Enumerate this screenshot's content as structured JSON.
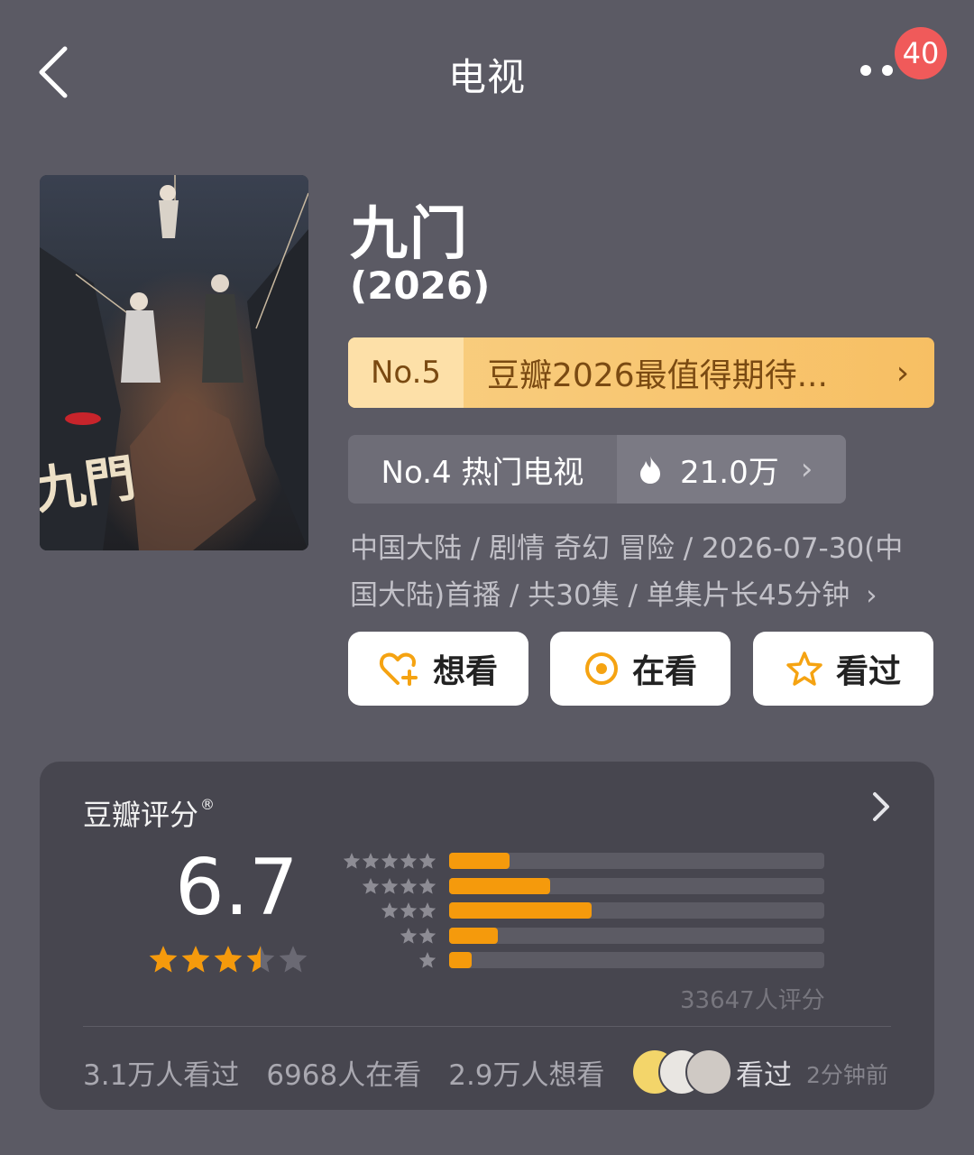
{
  "header": {
    "title": "电视",
    "badge_count": "40"
  },
  "show": {
    "title": "九门",
    "year": "(2026)",
    "poster_brand_mark": "九門"
  },
  "ranking_primary": {
    "no": "No.5",
    "label": "豆瓣2026最值得期待...",
    "chevron": "›"
  },
  "ranking_secondary": {
    "label": "No.4 热门电视",
    "heat": "21.0万",
    "chevron": "›"
  },
  "meta": {
    "text": "中国大陆 / 剧情 奇幻 冒险 / 2026-07-30(中国大陆)首播 / 共30集 / 单集片长45分钟",
    "chevron": "›"
  },
  "actions": {
    "want": "想看",
    "watching": "在看",
    "watched": "看过"
  },
  "rating": {
    "title": "豆瓣评分",
    "registered_mark": "®",
    "score": "6.7",
    "stars_value": 3.5,
    "rater_count": "33647人评分",
    "distribution": [
      {
        "stars": 5,
        "fraction": 0.16
      },
      {
        "stars": 4,
        "fraction": 0.27
      },
      {
        "stars": 3,
        "fraction": 0.38
      },
      {
        "stars": 2,
        "fraction": 0.13
      },
      {
        "stars": 1,
        "fraction": 0.06
      }
    ]
  },
  "stats": {
    "watched": "3.1万人看过",
    "watching": "6968人在看",
    "want": "2.9万人想看"
  },
  "friend_activity": {
    "label": "看过",
    "time": "2分钟前"
  },
  "colors": {
    "background": "#5b5a64",
    "card": "#47464f",
    "accent_orange": "#f59a0c",
    "rank_gold": "#f7bf63",
    "badge_red": "#f05a5a"
  }
}
